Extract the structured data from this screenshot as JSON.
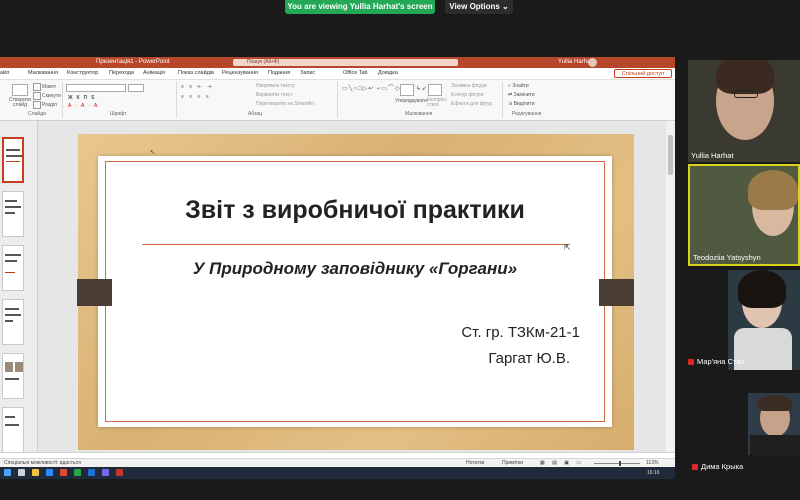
{
  "zoom": {
    "share_banner": "You are viewing Yullia Harhat's screen",
    "view_options": "View Options ⌄"
  },
  "powerpoint": {
    "title": "Презентація1 - PowerPoint",
    "search_placeholder": "Пошук (Alt+Ф)",
    "user_name": "Yullia Harhat",
    "share_label": "Спільний доступ",
    "menu": [
      "айл",
      "Малювання",
      "Конструктор",
      "Переходи",
      "Анімація",
      "Показ слайдів",
      "Рецензування",
      "Подання",
      "Запис",
      "Office Tab",
      "Довідка"
    ],
    "ribbon": {
      "new_slide": "Створити слайд",
      "layout": "Макет",
      "reset": "Скинути",
      "section": "Розділ",
      "groups": [
        "Слайди",
        "Шрифт",
        "Абзац",
        "Малювання",
        "Редагування"
      ],
      "arrange": "Упорядкувати",
      "quick_styles": "Експрес-стилі",
      "text_direction": "Напрямок тексту",
      "align_text": "Вирівняти текст",
      "smartart": "Перетворити на SmartArt",
      "shape_fill": "Заливка фігури",
      "shape_outline": "Контур фігури",
      "shape_effects": "Ефекти для фігур",
      "find": "Знайти",
      "replace": "Замінити",
      "select": "Виділити"
    },
    "slide": {
      "title": "Звіт з виробничої практики",
      "subtitle": "У Природному заповіднику «Горгани»",
      "group": "Ст. гр. ТЗКм-21-1",
      "author": "Гаргат Ю.В."
    },
    "notes_placeholder": "Спеціальні можливості: вдасться",
    "status": {
      "notes": "Нотатки",
      "comments": "Примітки",
      "zoom": "113%"
    },
    "tray_time": "16:16"
  },
  "participants": [
    {
      "name": "Yullia Harhat",
      "muted": false,
      "color": "#3a3a30"
    },
    {
      "name": "Teodoziia Yatsyshyn",
      "muted": false,
      "color": "#4f5a40"
    },
    {
      "name": "Мар'яна Стах",
      "muted": true,
      "color": "#2c3a44"
    },
    {
      "name": "Дима Крыка",
      "muted": true,
      "color": "#2f3b46"
    }
  ]
}
